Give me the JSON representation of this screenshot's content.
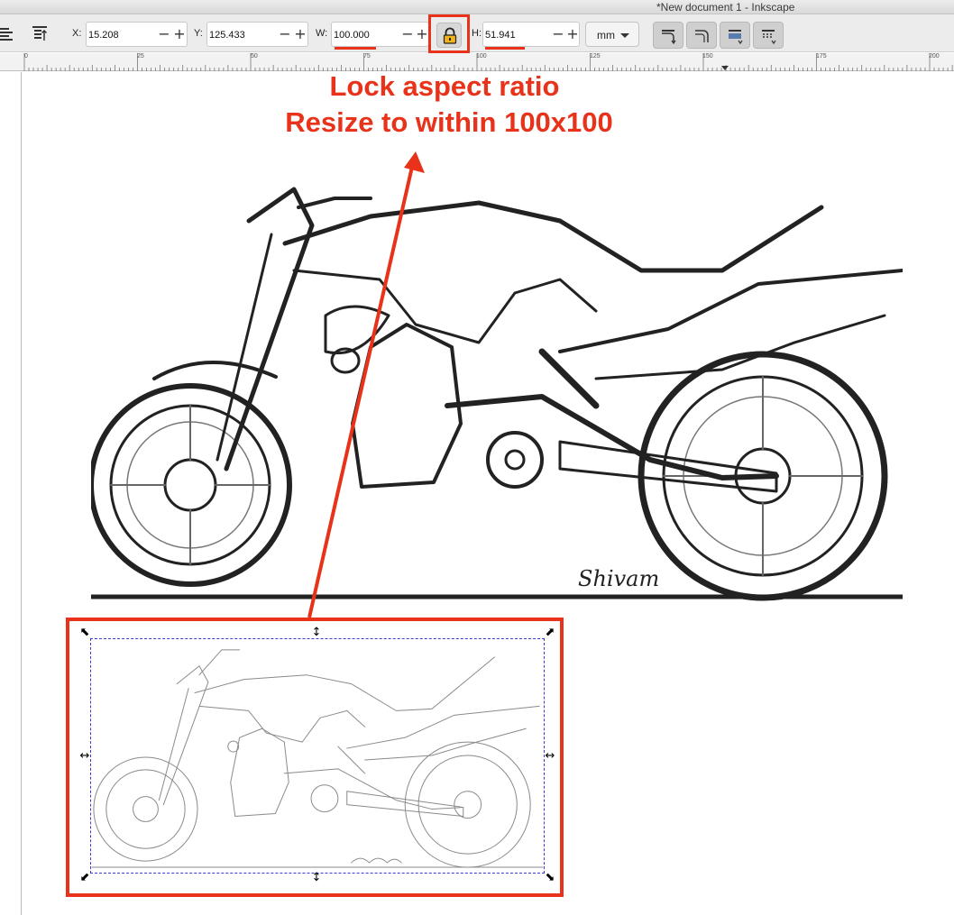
{
  "window": {
    "title": "*New document 1 - Inkscape"
  },
  "toolbar": {
    "x_label": "X:",
    "x_value": "15.208",
    "y_label": "Y:",
    "y_value": "125.433",
    "w_label": "W:",
    "w_value": "100.000",
    "h_label": "H:",
    "h_value": "51.941",
    "minus": "−",
    "plus": "+",
    "unit": "mm",
    "lock_state": "locked"
  },
  "ruler": {
    "labels": [
      "0",
      "25",
      "50",
      "75",
      "100",
      "125",
      "150",
      "175",
      "200"
    ]
  },
  "annotation": {
    "line1": "Lock aspect ratio",
    "line2": "Resize to within 100x100",
    "color": "#e8321a"
  },
  "artwork": {
    "signature": "Shivam"
  }
}
